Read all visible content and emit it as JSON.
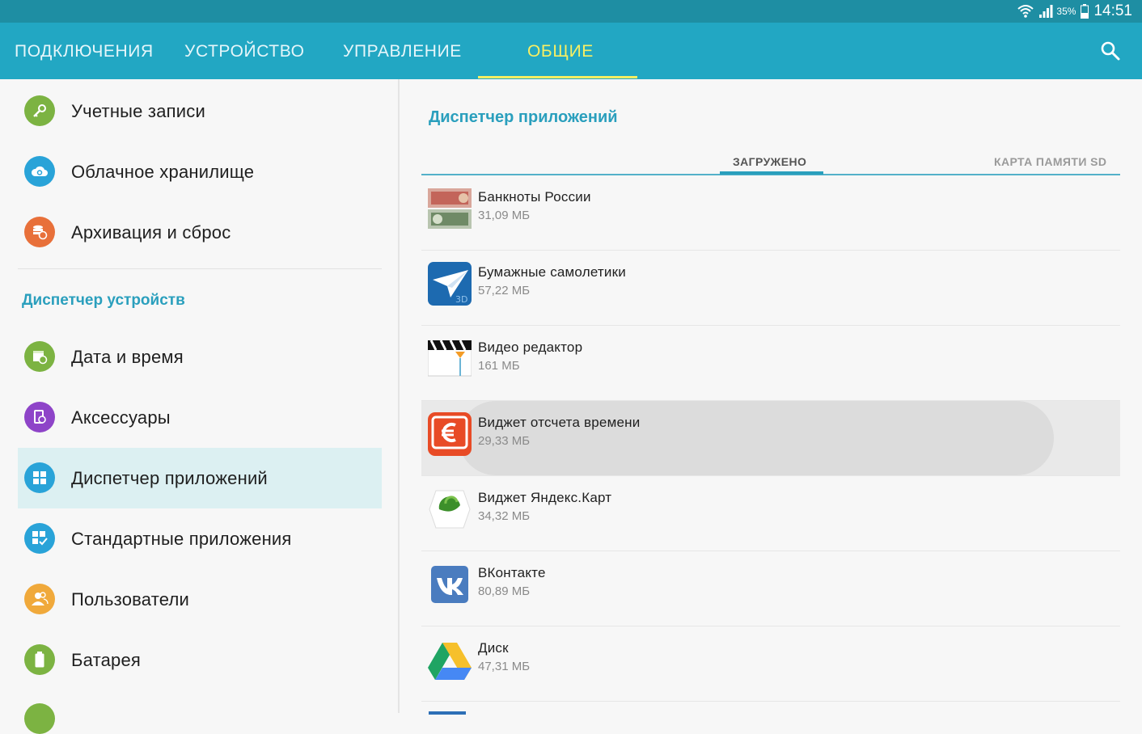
{
  "status_bar": {
    "battery_percent": "35%",
    "time": "14:51",
    "icons": [
      "wifi-icon",
      "signal-icon",
      "battery-icon"
    ]
  },
  "tabs": [
    {
      "label": "ПОДКЛЮЧЕНИЯ",
      "active": false
    },
    {
      "label": "УСТРОЙСТВО",
      "active": false
    },
    {
      "label": "УПРАВЛЕНИЕ",
      "active": false
    },
    {
      "label": "ОБЩИЕ",
      "active": true
    }
  ],
  "left_menu": {
    "items_top": [
      {
        "label": "Учетные записи",
        "icon": "key-icon",
        "color": "#7cb342"
      },
      {
        "label": "Облачное хранилище",
        "icon": "cloud-sync-icon",
        "color": "#29a3d8"
      },
      {
        "label": "Архивация и сброс",
        "icon": "database-reset-icon",
        "color": "#e8703a"
      }
    ],
    "section_title": "Диспетчер устройств",
    "items_section": [
      {
        "label": "Дата и время",
        "icon": "calendar-clock-icon",
        "color": "#7cb342"
      },
      {
        "label": "Аксессуары",
        "icon": "accessory-icon",
        "color": "#8e44c8"
      },
      {
        "label": "Диспетчер приложений",
        "icon": "apps-grid-icon",
        "color": "#29a3d8",
        "selected": true
      },
      {
        "label": "Стандартные приложения",
        "icon": "apps-check-icon",
        "color": "#29a3d8"
      },
      {
        "label": "Пользователи",
        "icon": "users-icon",
        "color": "#f0a93b"
      },
      {
        "label": "Батарея",
        "icon": "battery-icon",
        "color": "#7cb342"
      }
    ]
  },
  "right_panel": {
    "title": "Диспетчер приложений",
    "subtabs": [
      {
        "label": "ЗАГРУЖЕНО",
        "active": true
      },
      {
        "label": "КАРТА ПАМЯТИ SD",
        "active": false
      }
    ],
    "apps": [
      {
        "name": "Банкноты России",
        "size": "31,09 МБ",
        "icon": "banknotes-icon"
      },
      {
        "name": "Бумажные самолетики",
        "size": "57,22 МБ",
        "icon": "paper-plane-3d-icon",
        "icon_text": "3D"
      },
      {
        "name": "Видео редактор",
        "size": "161 МБ",
        "icon": "video-editor-icon"
      },
      {
        "name": "Виджет отсчета времени",
        "size": "29,33 МБ",
        "icon": "countdown-widget-icon",
        "pressed": true
      },
      {
        "name": "Виджет Яндекс.Карт",
        "size": "34,32 МБ",
        "icon": "yandex-maps-icon"
      },
      {
        "name": "ВКонтакте",
        "size": "80,89 МБ",
        "icon": "vk-icon"
      },
      {
        "name": "Диск",
        "size": "47,31 МБ",
        "icon": "google-drive-icon"
      }
    ]
  }
}
